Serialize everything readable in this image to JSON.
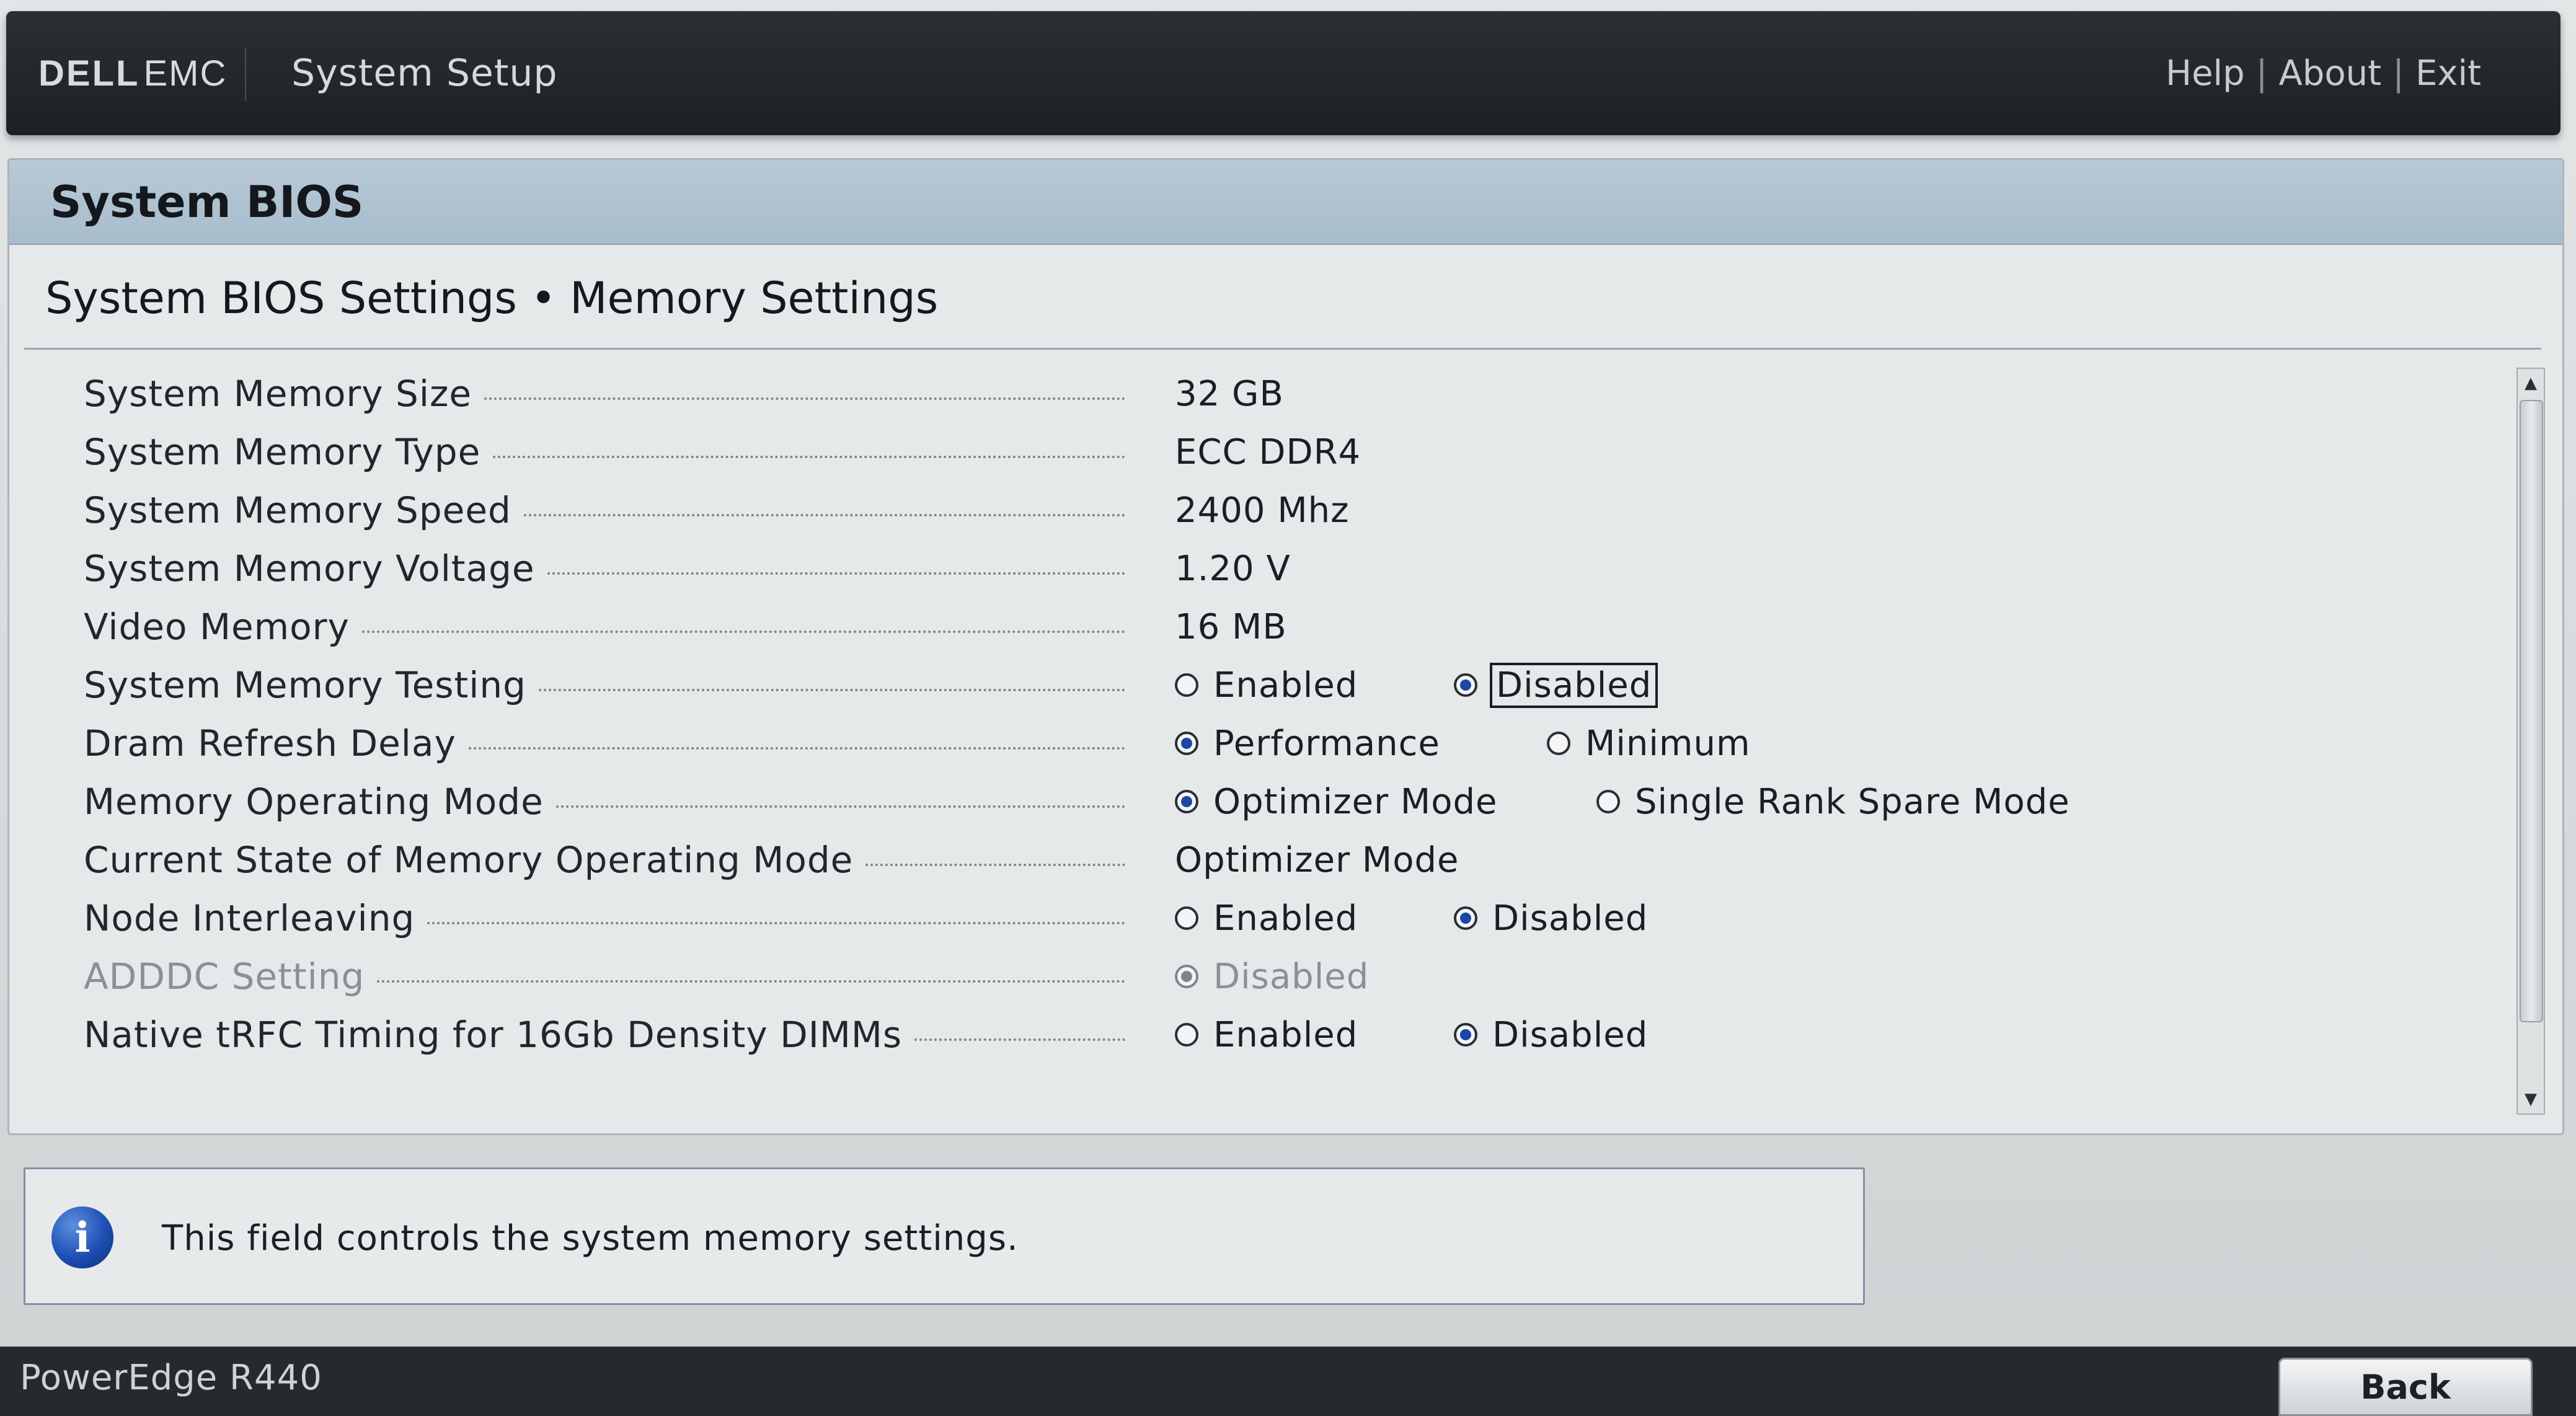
{
  "header": {
    "brand_dell": "DELL",
    "brand_emc": "EMC",
    "app_title": "System Setup",
    "links": {
      "help": "Help",
      "about": "About",
      "exit": "Exit",
      "separator": "|"
    }
  },
  "panel": {
    "title": "System BIOS",
    "breadcrumb": {
      "parent": "System BIOS Settings",
      "bullet": "•",
      "current": "Memory Settings"
    }
  },
  "settings": {
    "memory_size": {
      "label": "System Memory Size",
      "value": "32 GB"
    },
    "memory_type": {
      "label": "System Memory Type",
      "value": "ECC DDR4"
    },
    "memory_speed": {
      "label": "System Memory Speed",
      "value": "2400 Mhz"
    },
    "memory_voltage": {
      "label": "System Memory Voltage",
      "value": "1.20 V"
    },
    "video_memory": {
      "label": "Video Memory",
      "value": "16 MB"
    },
    "memory_testing": {
      "label": "System Memory Testing",
      "opt1": "Enabled",
      "opt2": "Disabled",
      "selected": "Disabled"
    },
    "dram_refresh": {
      "label": "Dram Refresh Delay",
      "opt1": "Performance",
      "opt2": "Minimum",
      "selected": "Performance"
    },
    "operating_mode": {
      "label": "Memory Operating Mode",
      "opt1": "Optimizer Mode",
      "opt2": "Single Rank Spare Mode",
      "selected": "Optimizer Mode"
    },
    "current_state": {
      "label": "Current State of Memory Operating Mode",
      "value": "Optimizer Mode"
    },
    "node_interleaving": {
      "label": "Node Interleaving",
      "opt1": "Enabled",
      "opt2": "Disabled",
      "selected": "Disabled"
    },
    "adddc": {
      "label": "ADDDC Setting",
      "opt1": "Disabled",
      "selected": "Disabled",
      "state": "disabled"
    },
    "native_trfc": {
      "label": "Native tRFC Timing for 16Gb Density DIMMs",
      "opt1": "Enabled",
      "opt2": "Disabled",
      "selected": "Disabled"
    }
  },
  "help": {
    "icon": "info-icon",
    "text": "This field controls the system memory settings."
  },
  "footer": {
    "model": "PowerEdge R440",
    "back_label": "Back"
  },
  "colors": {
    "header_bg": "#1d2124",
    "panel_header_bg": "#a7bccc",
    "radio_selected": "#1e46a5",
    "footer_bg": "#262a2e"
  }
}
